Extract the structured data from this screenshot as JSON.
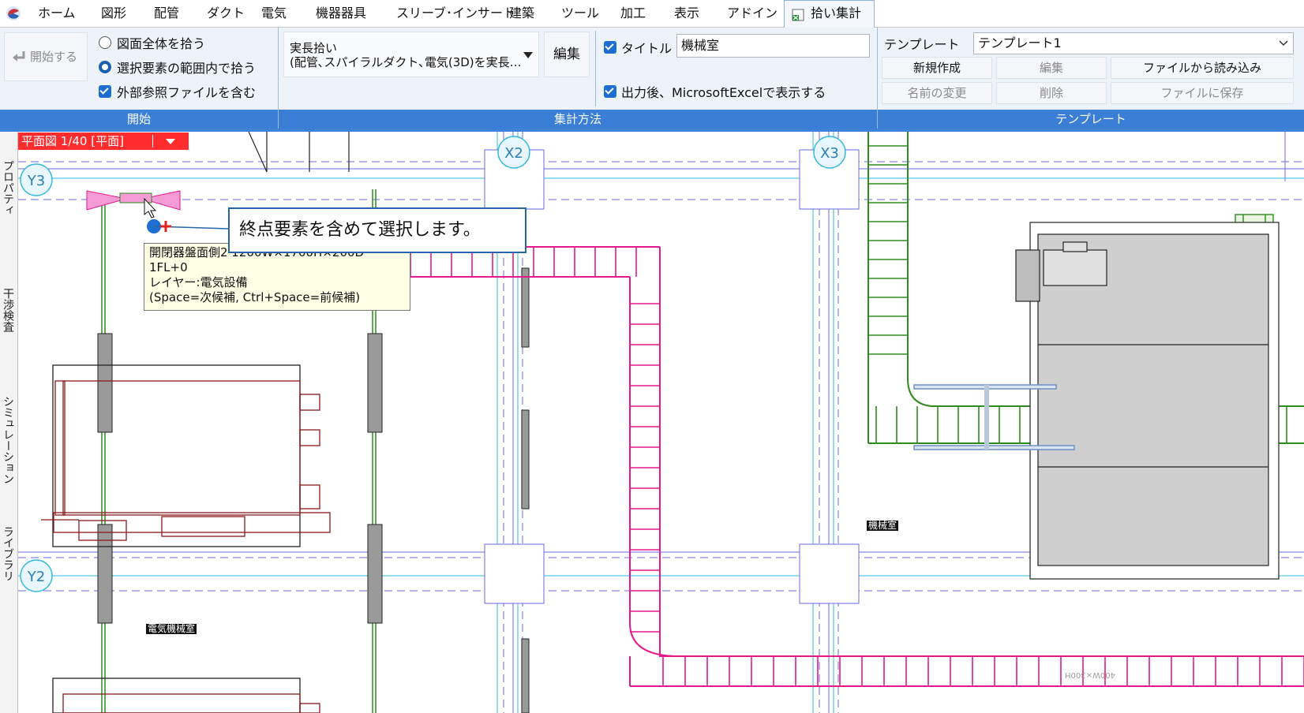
{
  "menu": {
    "items": [
      "ホーム",
      "図形",
      "配管",
      "ダクト",
      "電気",
      "機器器具",
      "スリーブ･インサート",
      "建築",
      "ツール",
      "加工",
      "表示",
      "アドイン"
    ],
    "active_tab": "拾い集計"
  },
  "ribbon": {
    "start_group": {
      "label": "開始",
      "start_button": "開始する",
      "option_whole": "図面全体を拾う",
      "option_selection": "選択要素の範囲内で拾う",
      "include_xref": "外部参照ファイルを含む"
    },
    "method_group": {
      "label": "集計方法",
      "dropdown_line1": "実長拾い",
      "dropdown_line2": "(配管､スパイラルダクト､電気(3D)を実長…",
      "edit_button": "編集",
      "title_check": "タイトル",
      "title_value": "機械室",
      "excel_check": "出力後、MicrosoftExcelで表示する"
    },
    "template_group": {
      "label": "テンプレート",
      "template_label": "テンプレート",
      "template_value": "テンプレート1",
      "new_button": "新規作成",
      "edit_button": "編集",
      "load_button": "ファイルから読み込み",
      "rename_button": "名前の変更",
      "delete_button": "削除",
      "save_button": "ファイルに保存"
    }
  },
  "sidebar": {
    "tabs": [
      "プロパティ",
      "干渉検査",
      "シミュレーション",
      "ライブラリ"
    ]
  },
  "canvas": {
    "view_label": "平面図 1/40 [平面]",
    "grid_labels": {
      "x2": "X2",
      "x3": "X3",
      "y3": "Y3",
      "y2": "Y2"
    },
    "callout_text": "終点要素を含めて選択します。",
    "tooltip": {
      "line1": "開閉器盤面側2 1200W×1700H×200D",
      "line2": "1FL+0",
      "line3": "レイヤー:電気設備",
      "line4": "(Space=次候補, Ctrl+Space=前候補)"
    },
    "room_tags": [
      "機械室",
      "電気機械室"
    ],
    "duct_note": "400W×300H"
  },
  "colors": {
    "ribbon_accent": "#3a7fd5",
    "view_label_bg": "#ff2d2d",
    "duct_magenta": "#e6198c",
    "pipe_green": "#2e8b1e",
    "equipment_red": "#8b1a1a",
    "grid_blue": "#6a6ae6"
  }
}
